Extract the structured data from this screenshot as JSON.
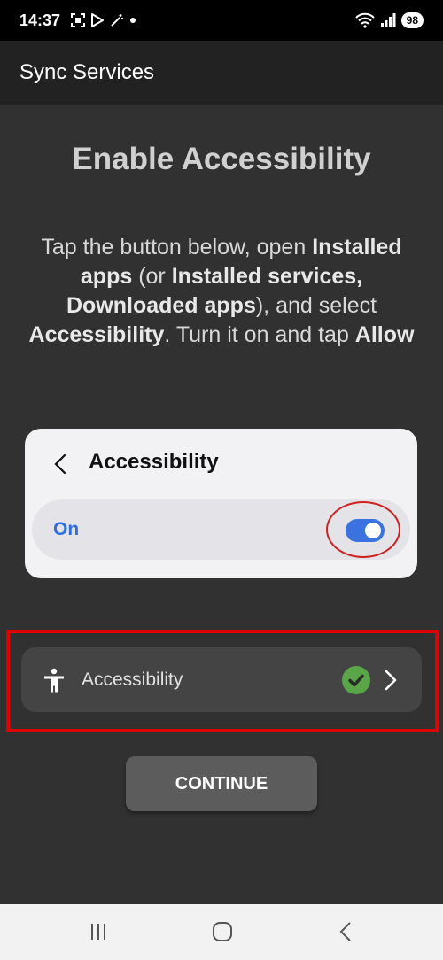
{
  "status_bar": {
    "time": "14:37",
    "battery": "98"
  },
  "app_bar": {
    "title": "Sync Services"
  },
  "main": {
    "heading": "Enable Accessibility",
    "instruction": {
      "p1": "Tap the button below, open ",
      "b1": "Installed apps",
      "p2": " (or ",
      "b2": "Installed services, Downloaded apps",
      "p3": "), and select ",
      "b3": "Accessibility",
      "p4": ". Turn it on and tap ",
      "b4": "Allow"
    }
  },
  "preview_card": {
    "title": "Accessibility",
    "toggle_label": "On",
    "toggle_state": "on",
    "toggle_color": "#3a73e0"
  },
  "accessibility_item": {
    "label": "Accessibility",
    "status": "enabled",
    "status_color": "#5aa548",
    "icon": "accessibility-icon"
  },
  "continue_button": {
    "label": "CONTINUE"
  },
  "colors": {
    "highlight": "#e00000",
    "background": "#313131"
  }
}
